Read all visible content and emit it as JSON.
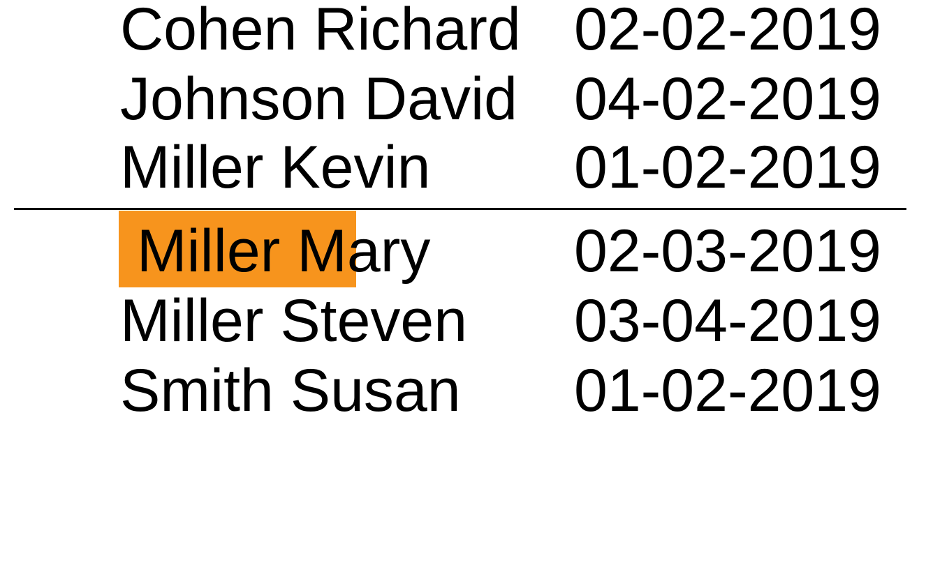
{
  "colors": {
    "highlight": "#F7941D"
  },
  "rows_above": [
    {
      "name": "Cohen Richard",
      "date": "02-02-2019"
    },
    {
      "name": "Johnson David",
      "date": "04-02-2019"
    },
    {
      "name": "Miller Kevin",
      "date": "01-02-2019"
    }
  ],
  "highlighted_row": {
    "name_highlighted": " Miller M",
    "name_rest": "ary",
    "date": "02-03-2019"
  },
  "rows_below": [
    {
      "name": "Miller Steven",
      "date": "03-04-2019"
    },
    {
      "name": "Smith Susan",
      "date": "01-02-2019"
    }
  ]
}
